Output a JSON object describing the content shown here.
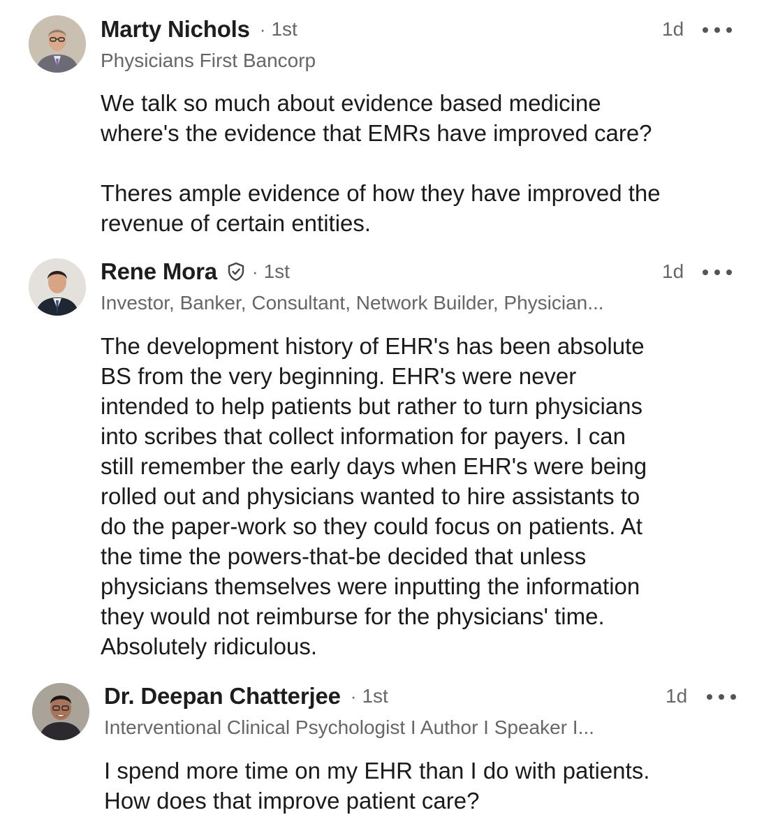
{
  "comments": [
    {
      "author": "Marty Nichols",
      "verified": false,
      "degree": "1st",
      "time": "1d",
      "headline": "Physicians First Bancorp",
      "body": "We talk so much about evidence based medicine\nwhere's the evidence that EMRs have improved care?\n\nTheres ample evidence of how they have improved the\nrevenue of certain entities."
    },
    {
      "author": "Rene Mora",
      "verified": true,
      "degree": "1st",
      "time": "1d",
      "headline": "Investor, Banker, Consultant, Network Builder, Physician...",
      "body": "The development history of EHR's has been absolute\nBS from the very beginning. EHR's were never\nintended to help patients but rather to turn physicians\ninto scribes that collect information for payers. I can\nstill remember the early days when EHR's were being\nrolled out and physicians wanted to hire assistants to\ndo the paper-work so they could focus on patients. At\nthe time the powers-that-be decided that unless\nphysicians themselves were inputting the information\nthey would not reimburse for the physicians' time.\nAbsolutely ridiculous."
    },
    {
      "author": "Dr. Deepan Chatterjee",
      "verified": false,
      "degree": "1st",
      "time": "1d",
      "headline": "Interventional Clinical Psychologist I Author I Speaker I...",
      "body": "I spend more time on my EHR than I do with patients.\nHow does that improve patient care?"
    }
  ],
  "separator": "·",
  "icons": {
    "more": "more-options-icon",
    "verified": "verified-shield-icon"
  },
  "colors": {
    "name": "#1d1d1d",
    "meta": "#666666",
    "body": "#1a1a1a"
  }
}
